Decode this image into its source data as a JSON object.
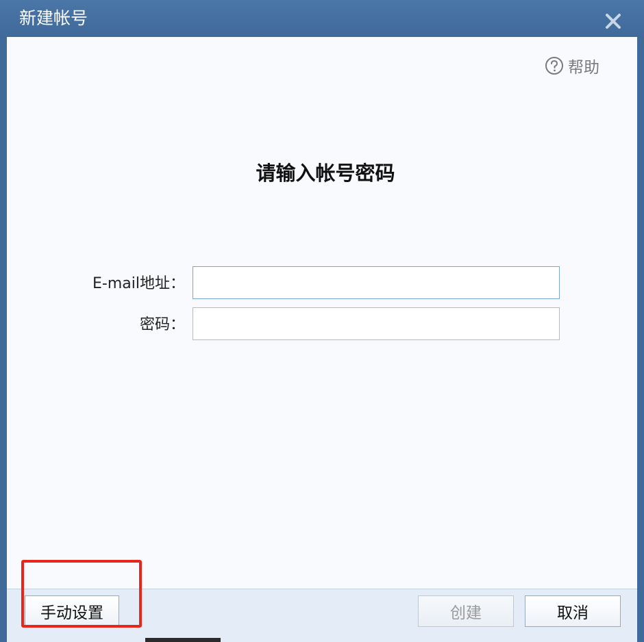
{
  "window": {
    "title": "新建帐号"
  },
  "icons": {
    "close": "close-icon",
    "help": "question-circle-icon"
  },
  "help": {
    "label": "帮助"
  },
  "form": {
    "heading": "请输入帐号密码",
    "email_label": "E-mail地址：",
    "email_value": "",
    "password_label": "密码：",
    "password_value": ""
  },
  "footer": {
    "manual_setup_label": "手动设置",
    "create_label": "创建",
    "create_enabled": false,
    "cancel_label": "取消"
  },
  "colors": {
    "titlebar": "#3f6a9a",
    "content_bg": "#f8fafd",
    "highlight": "#e8261c"
  }
}
